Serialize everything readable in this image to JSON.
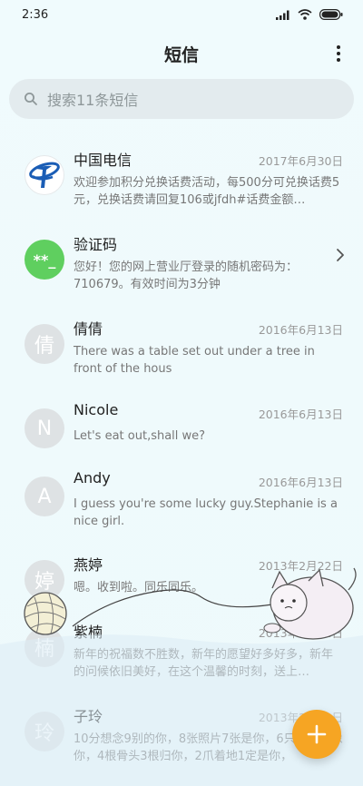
{
  "status_bar": {
    "time": "2:36"
  },
  "header": {
    "title": "短信"
  },
  "search": {
    "placeholder": "搜索11条短信"
  },
  "conversations": [
    {
      "name": "中国电信",
      "date": "2017年6月30日",
      "snippet": "欢迎参加积分兑换话费活动，每500分可兑换话费5元，兑换话费请回复106或jfdh#话费金额…",
      "avatar_icon": "china-telecom-logo"
    },
    {
      "name": "验证码",
      "date": "",
      "snippet": "您好！您的网上营业厅登录的随机密码为：710679。有效时间为3分钟",
      "avatar_text": "**_"
    },
    {
      "name": "倩倩",
      "date": "2016年6月13日",
      "snippet": "There was a table set out under a tree in front of the hous",
      "avatar_text": "倩"
    },
    {
      "name": "Nicole",
      "date": "2016年6月13日",
      "snippet": "Let's eat out,shall we?",
      "avatar_text": "N"
    },
    {
      "name": "Andy",
      "date": "2016年6月13日",
      "snippet": "I guess you're some lucky guy.Stephanie is a nice girl.",
      "avatar_text": "A"
    },
    {
      "name": "燕婷",
      "date": "2013年2月22日",
      "snippet": "嗯。收到啦。同乐同乐。",
      "avatar_text": "婷"
    },
    {
      "name": "紫楠",
      "date": "2013年2月22日",
      "snippet": "新年的祝福数不胜数，新年的愿望好多好多，新年的问候依旧美好，在这个温馨的时刻，送上…",
      "avatar_text": "楠"
    },
    {
      "name": "子玲",
      "date": "2013年2月22日",
      "snippet": "10分想念9别的你，8张照片7张是你，6只手…只像你，4根骨头3根归你，2爪着地1定是你，",
      "avatar_text": "玲"
    }
  ],
  "colors": {
    "accent": "#f6a523",
    "verify_avatar": "#5fcf5f",
    "telecom_blue": "#1a5db5"
  }
}
